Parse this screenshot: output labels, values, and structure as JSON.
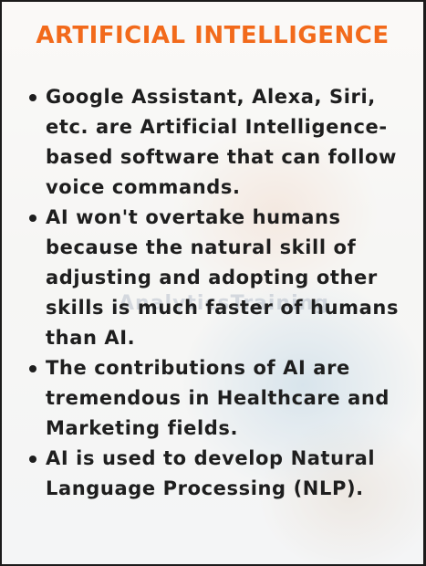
{
  "title": "ARTIFICIAL INTELLIGENCE",
  "watermark": "AnalyticsTraining",
  "items": [
    {
      "text": "Google Assistant, Alexa, Siri, etc. are Artificial Intelligence-based software that can follow voice commands."
    },
    {
      "text": "AI won't overtake humans because the natural skill of adjusting and adopting other skills is much faster of humans than AI."
    },
    {
      "text": "The contributions of AI are tremendous in Healthcare and Marketing fields."
    },
    {
      "text": "AI is used to develop Natural Language Processing (NLP)."
    }
  ],
  "colors": {
    "title": "#f26a1b",
    "text": "#1e1e1e"
  }
}
